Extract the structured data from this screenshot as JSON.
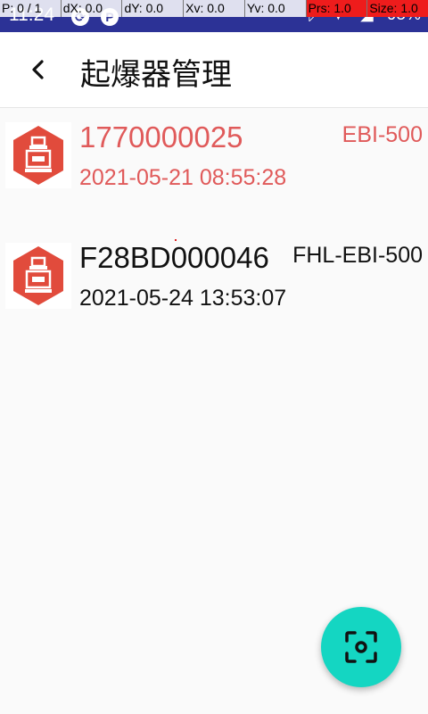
{
  "status_bar": {
    "time": "11:24",
    "app_icon_letter": "P",
    "battery": "95%",
    "icons": [
      "sync-icon",
      "app-p-icon",
      "bluetooth-icon",
      "wifi-icon",
      "signal-icon",
      "battery-icon"
    ]
  },
  "pointer_overlay": {
    "p": "P: 0 / 1",
    "dx": "dX: 0.0",
    "dy": "dY: 0.0",
    "xv": "Xv: 0.0",
    "yv": "Yv: 0.0",
    "prs": "Prs: 1.0",
    "size": "Size: 1.0"
  },
  "header": {
    "title": "起爆器管理",
    "back_icon": "chevron-left-icon"
  },
  "devices": [
    {
      "id": "1770000025",
      "model": "EBI-500",
      "time": "2021-05-21 08:55:28",
      "state": "active"
    },
    {
      "id": "F28BD000046",
      "model": "FHL-EBI-500",
      "time": "2021-05-24 13:53:07",
      "state": "normal"
    }
  ],
  "fab": {
    "icon": "scan-icon"
  },
  "colors": {
    "status_bar": "#2c3296",
    "active_text": "#e05a5a",
    "device_icon": "#e14b3c",
    "fab": "#14d6c2"
  }
}
